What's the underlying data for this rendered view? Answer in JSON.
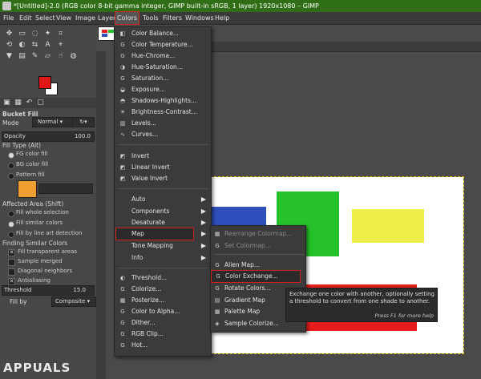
{
  "window": {
    "title": "*[Untitled]-2.0 (RGB color 8-bit gamma integer, GIMP built-in sRGB, 1 layer) 1920x1080 – GIMP"
  },
  "menubar": [
    "File",
    "Edit",
    "Select",
    "View",
    "Image",
    "Layer",
    "Colors",
    "Tools",
    "Filters",
    "Windows",
    "Help"
  ],
  "tool_options": {
    "title": "Bucket Fill",
    "mode_label": "Mode",
    "mode_value": "Normal",
    "opacity_label": "Opacity",
    "opacity_value": "100.0",
    "fill_type_label": "Fill Type  (Alt)",
    "fill_types": [
      "FG color fill",
      "BG color fill",
      "Pattern fill"
    ],
    "affected_area_label": "Affected Area  (Shift)",
    "affected_areas": [
      "Fill whole selection",
      "Fill similar colors",
      "Fill by line art detection"
    ],
    "finding_label": "Finding Similar Colors",
    "finding_options": [
      "Fill transparent areas",
      "Sample merged",
      "Diagonal neighbors",
      "Antialiasing"
    ],
    "threshold_label": "Threshold",
    "threshold_value": "15.0",
    "fillby_label": "Fill by",
    "fillby_value": "Composite"
  },
  "colors_menu": {
    "group1": [
      "Color Balance...",
      "Color Temperature...",
      "Hue-Chroma...",
      "Hue-Saturation...",
      "Saturation...",
      "Exposure...",
      "Shadows-Highlights...",
      "Brightness-Contrast...",
      "Levels...",
      "Curves..."
    ],
    "group2": [
      "Invert",
      "Linear Invert",
      "Value Invert"
    ],
    "group3": [
      "Auto",
      "Components",
      "Desaturate",
      "Map",
      "Tone Mapping",
      "Info"
    ],
    "group4": [
      "Threshold...",
      "Colorize...",
      "Posterize...",
      "Color to Alpha...",
      "Dither...",
      "RGB Clip...",
      "Hot..."
    ]
  },
  "map_menu": {
    "items": [
      "Rearrange Colormap...",
      "Set Colormap...",
      "Alien Map...",
      "Color Exchange...",
      "Rotate Colors...",
      "Gradient Map",
      "Palette Map",
      "Sample Colorize..."
    ]
  },
  "tooltip": {
    "text": "Exchange one color with another, optionally setting a threshold to convert from one shade to another.",
    "hint": "Press F1 for more help"
  },
  "watermark": "APPUALS",
  "colors": {
    "fg": "#e01515",
    "bg": "#ffffff",
    "blue": "#2f4fbd",
    "green": "#25c22a",
    "yellow": "#f0ee4a",
    "red": "#e51d1d"
  }
}
